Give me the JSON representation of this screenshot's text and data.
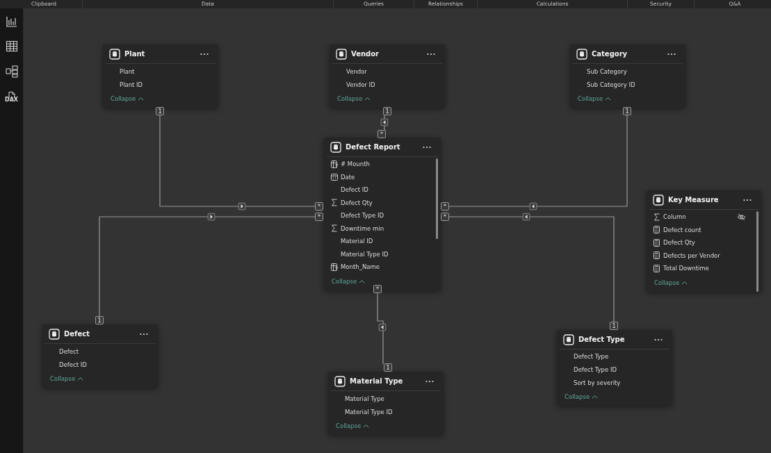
{
  "ribbon_groups": [
    "Clipboard",
    "Data",
    "Queries",
    "Relationships",
    "Calculations",
    "Security",
    "Q&A"
  ],
  "sidebar": {
    "dax_label": "DAX"
  },
  "tables": [
    {
      "name": "Plant",
      "fields": [
        {
          "name": "Plant",
          "kind": "column"
        },
        {
          "name": "Plant ID",
          "kind": "column"
        }
      ],
      "collapse": "Collapse"
    },
    {
      "name": "Vendor",
      "fields": [
        {
          "name": "Vendor",
          "kind": "column"
        },
        {
          "name": "Vendor ID",
          "kind": "column"
        }
      ],
      "collapse": "Collapse"
    },
    {
      "name": "Category",
      "fields": [
        {
          "name": "Sub Category",
          "kind": "column"
        },
        {
          "name": "Sub Category ID",
          "kind": "column"
        }
      ],
      "collapse": "Collapse"
    },
    {
      "name": "Defect Report",
      "fields": [
        {
          "name": "# Mounth",
          "kind": "calculated"
        },
        {
          "name": "Date",
          "kind": "date"
        },
        {
          "name": "Defect ID",
          "kind": "column"
        },
        {
          "name": "Defect Qty",
          "kind": "sum"
        },
        {
          "name": "Defect Type ID",
          "kind": "column"
        },
        {
          "name": "Downtime min",
          "kind": "sum"
        },
        {
          "name": "Material ID",
          "kind": "column"
        },
        {
          "name": "Material Type ID",
          "kind": "column"
        },
        {
          "name": "Month_Name",
          "kind": "calculated"
        }
      ],
      "collapse": "Collapse"
    },
    {
      "name": "Key Measure",
      "fields": [
        {
          "name": "Column",
          "kind": "sum",
          "hidden": true
        },
        {
          "name": "Defect count",
          "kind": "measure"
        },
        {
          "name": "Defect Qty",
          "kind": "measure"
        },
        {
          "name": "Defects per Vendor",
          "kind": "measure"
        },
        {
          "name": "Total Downtime",
          "kind": "measure"
        }
      ],
      "collapse": "Collapse"
    },
    {
      "name": "Defect",
      "fields": [
        {
          "name": "Defect",
          "kind": "column"
        },
        {
          "name": "Defect ID",
          "kind": "column"
        }
      ],
      "collapse": "Collapse"
    },
    {
      "name": "Material Type",
      "fields": [
        {
          "name": "Material Type",
          "kind": "column"
        },
        {
          "name": "Material Type ID",
          "kind": "column"
        }
      ],
      "collapse": "Collapse"
    },
    {
      "name": "Defect Type",
      "fields": [
        {
          "name": "Defect Type",
          "kind": "column"
        },
        {
          "name": "Defect Type ID",
          "kind": "column"
        },
        {
          "name": "Sort by severity",
          "kind": "column"
        }
      ],
      "collapse": "Collapse"
    }
  ],
  "relationships": [
    {
      "one": "1",
      "many": "*"
    },
    {
      "one": "1",
      "many": "*"
    },
    {
      "one": "1",
      "many": "*"
    },
    {
      "one": "1",
      "many": "*"
    },
    {
      "one": "1",
      "many": "*"
    },
    {
      "one": "1",
      "many": "*"
    }
  ]
}
